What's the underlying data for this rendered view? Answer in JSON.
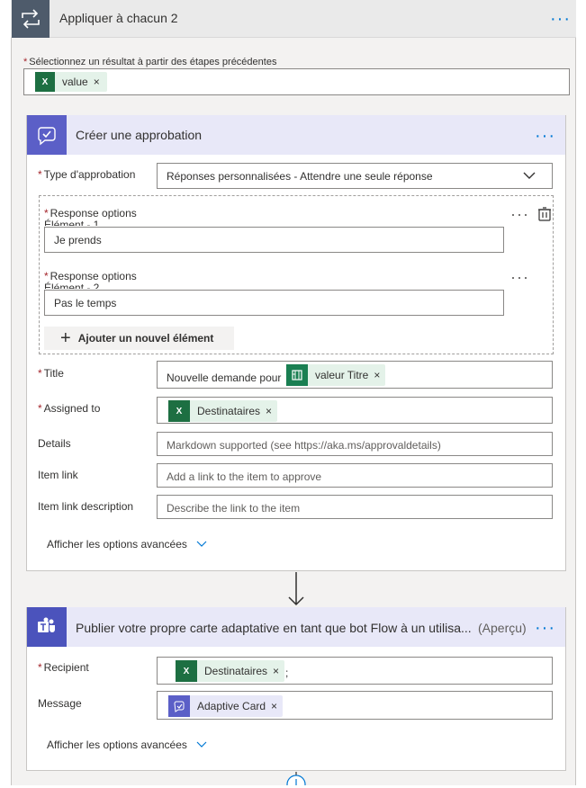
{
  "loop": {
    "title": "Appliquer à chacun 2",
    "field_label": "Sélectionnez un résultat à partir des étapes précédentes",
    "token_value": "value",
    "remove": "×"
  },
  "approval": {
    "title": "Créer une approbation",
    "type_label": "Type d'approbation",
    "type_value": "Réponses personnalisées - Attendre une seule réponse",
    "opt1_label": "Response options Élément - 1",
    "opt1_value": "Je prends",
    "opt2_label": "Response options Élément - 2",
    "opt2_value": "Pas le temps",
    "add_item": "Ajouter un nouvel élément",
    "title_label": "Title",
    "title_prefix": "Nouvelle demande pour",
    "title_token": "valeur Titre",
    "assigned_label": "Assigned to",
    "assigned_token": "Destinataires",
    "details_label": "Details",
    "details_placeholder": "Markdown supported (see https://aka.ms/approvaldetails)",
    "itemlink_label": "Item link",
    "itemlink_placeholder": "Add a link to the item to approve",
    "itemlinkdesc_label": "Item link description",
    "itemlinkdesc_placeholder": "Describe the link to the item",
    "advanced": "Afficher les options avancées"
  },
  "teams": {
    "title": "Publier votre propre carte adaptative en tant que bot Flow à un utilisa...",
    "preview": "(Aperçu)",
    "recipient_label": "Recipient",
    "recipient_token": "Destinataires",
    "recipient_suffix": ";",
    "message_label": "Message",
    "message_token": "Adaptive Card",
    "advanced": "Afficher les options avancées"
  },
  "icons": {
    "required": "*",
    "more": "···",
    "chevron": "⌵",
    "plus": "+",
    "arrow_down": "↓"
  },
  "colors": {
    "accent": "#0078d4",
    "approval_brand": "#5b5fc7",
    "teams_brand": "#4b53bc",
    "excel": "#1d6f42",
    "required": "#a4262c"
  }
}
